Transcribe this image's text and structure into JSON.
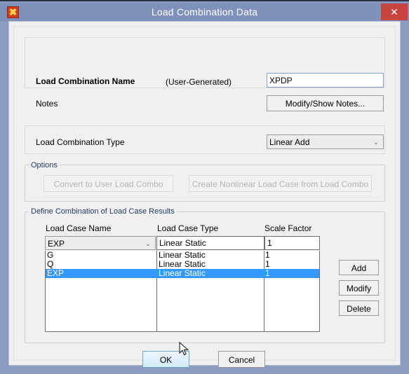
{
  "window": {
    "title": "Load Combination Data",
    "app_icon": "sap2000-logo-icon",
    "close_label": "✕",
    "icon_glyph": "✖",
    "titlebar_color": "#7f91bb",
    "close_button_color": "#c8443f",
    "selection_color": "#3399ff"
  },
  "name_section": {
    "name_label": "Load Combination Name",
    "generated_label": "(User-Generated)",
    "name_value": "XPDP",
    "name_placeholder": "",
    "notes_label": "Notes",
    "notes_button": "Modify/Show Notes..."
  },
  "type_section": {
    "label": "Load Combination Type",
    "selected": "Linear Add",
    "options": [
      "Linear Add"
    ],
    "arrow": "⌄"
  },
  "options_group": {
    "title": "Options",
    "convert_button": "Convert to User Load Combo",
    "create_button": "Create Nonlinear Load Case from Load Combo"
  },
  "define_group": {
    "title": "Define Combination of Load Case Results",
    "columns": [
      "Load Case Name",
      "Load Case Type",
      "Scale Factor"
    ],
    "editor": {
      "load_case_name": "EXP",
      "load_case_name_options": [
        "EXP",
        "G",
        "Q"
      ],
      "load_case_type": "Linear Static",
      "scale_factor": "1",
      "arrow": "⌄"
    },
    "rows": [
      {
        "name": "G",
        "type": "Linear Static",
        "scale": "1",
        "selected": false
      },
      {
        "name": "Q",
        "type": "Linear Static",
        "scale": "1",
        "selected": false
      },
      {
        "name": "EXP",
        "type": "Linear Static",
        "scale": "1",
        "selected": true
      }
    ],
    "side_buttons": {
      "add": "Add",
      "modify": "Modify",
      "delete": "Delete"
    }
  },
  "footer": {
    "ok": "OK",
    "cancel": "Cancel"
  }
}
